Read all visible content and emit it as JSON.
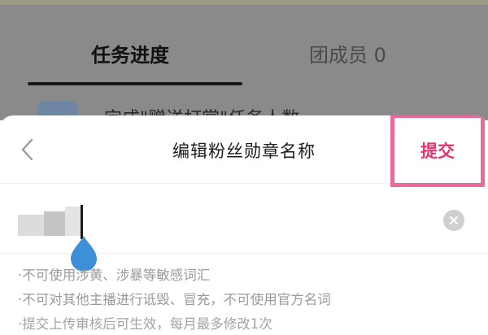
{
  "background": {
    "tabs": [
      {
        "label": "任务进度",
        "active": true
      },
      {
        "label": "团成员 0",
        "active": false
      }
    ],
    "row_text": "完成\"赠送打赏\"任务人数"
  },
  "sheet": {
    "title": "编辑粉丝勋章名称",
    "submit_label": "提交",
    "back_icon": "chevron-left-icon",
    "clear_icon": "clear-circle-icon",
    "rules": [
      "·不可使用涉黄、涉暴等敏感词汇",
      "·不可对其他主播进行诋毁、冒充，不可使用官方名词",
      "·提交上传审核后可生效，每月最多修改1次"
    ]
  },
  "colors": {
    "accent": "#e8336f",
    "highlight_border": "#ea6a9c",
    "caret_handle": "#3d8fd8"
  }
}
